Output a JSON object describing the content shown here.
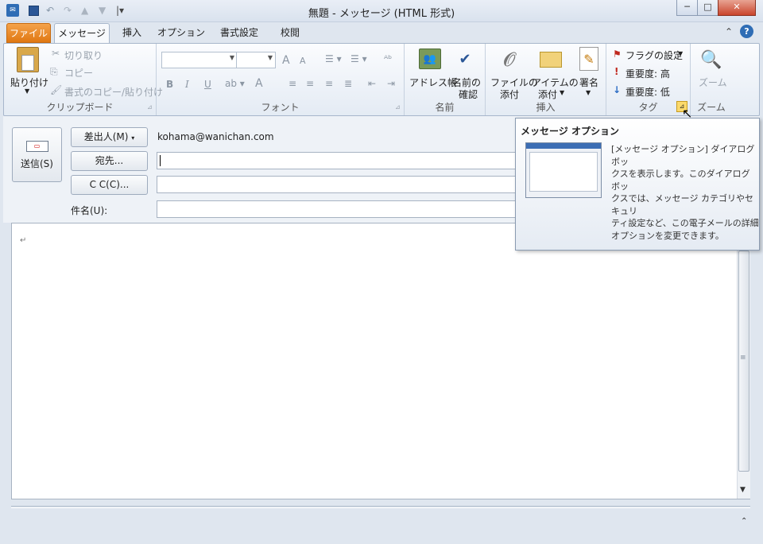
{
  "window": {
    "title": "無題 - メッセージ (HTML 形式)",
    "minimize": "─",
    "maximize": "□",
    "close": "✕"
  },
  "qat": {
    "app_icon": "outlook-icon",
    "save": "save-icon",
    "undo": "undo-icon",
    "redo": "redo-icon",
    "up": "up-icon",
    "down": "down-icon",
    "customize": "customize-icon"
  },
  "tabs": [
    {
      "label": "ファイル"
    },
    {
      "label": "メッセージ"
    },
    {
      "label": "挿入"
    },
    {
      "label": "オプション"
    },
    {
      "label": "書式設定"
    },
    {
      "label": "校閲"
    }
  ],
  "ribbon": {
    "clipboard": {
      "paste": "貼り付け",
      "cut": "切り取り",
      "copy": "コピー",
      "format_painter": "書式のコピー/貼り付け",
      "label": "クリップボード"
    },
    "font": {
      "label": "フォント",
      "bold": "B",
      "italic": "I",
      "underline": "U",
      "grow": "A",
      "shrink": "A",
      "color": "A"
    },
    "names": {
      "address_book": "アドレス帳",
      "check_names_1": "名前の",
      "check_names_2": "確認",
      "label": "名前"
    },
    "include": {
      "attach_file_1": "ファイルの",
      "attach_file_2": "添付",
      "attach_item_1": "アイテムの",
      "attach_item_2": "添付",
      "signature": "署名",
      "label": "挿入"
    },
    "tags": {
      "flag": "フラグの設定",
      "high": "重要度: 高",
      "low": "重要度: 低",
      "label": "タグ"
    },
    "zoom": {
      "zoom": "ズーム",
      "label": "ズーム"
    }
  },
  "header": {
    "send": "送信(S)",
    "from_button": "差出人(M)",
    "from_value": "kohama@wanichan.com",
    "to_button": "宛先...",
    "cc_button": "C C(C)...",
    "subject_label": "件名(U):"
  },
  "body": {
    "cursor_mark": "↵"
  },
  "tooltip": {
    "title": "メッセージ オプション",
    "desc_1": "[メッセージ オプション] ダイアログ ボッ",
    "desc_2": "クスを表示します。このダイアログ ボッ",
    "desc_3": "クスでは、メッセージ カテゴリやセキュリ",
    "desc_4": "ティ設定など、この電子メールの詳細",
    "desc_5": "オプションを変更できます。"
  },
  "colors": {
    "file_tab": "#e07812",
    "accent": "#2b5797",
    "ribbon_bg": "#f7f9fc"
  }
}
